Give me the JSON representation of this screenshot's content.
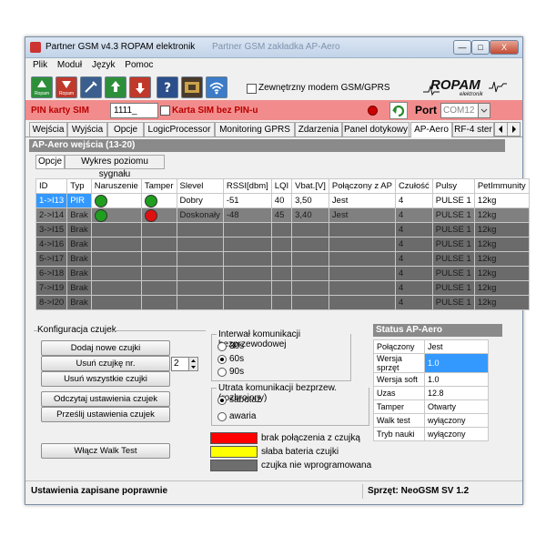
{
  "title": "Partner GSM v4.3 ROPAM elektronik",
  "title_ghost": "Partner GSM zakładka AP-Aero",
  "window_buttons": {
    "minimize": "—",
    "maximize": "□",
    "close": "X"
  },
  "menu": [
    "Plik",
    "Moduł",
    "Język",
    "Pomoc"
  ],
  "toolbar": {
    "labels": [
      "Ropam",
      "Ropam",
      "",
      "",
      "",
      "",
      "",
      ""
    ],
    "external_modem_label": "Zewnętrzny modem GSM/GPRS",
    "logo_text": "ROPAM",
    "logo_sub": "elektronik"
  },
  "pin": {
    "label": "PIN karty SIM",
    "value": "1111_",
    "no_pin_label": "Karta SIM bez PIN-u",
    "port_label": "Port",
    "port_value": "COM12"
  },
  "tabs": [
    "Wejścia",
    "Wyjścia",
    "Opcje",
    "LogicProcessor",
    "Monitoring GPRS",
    "Zdarzenia",
    "Panel dotykowy",
    "AP-Aero",
    "RF-4 ster"
  ],
  "active_tab": "AP-Aero",
  "section_title": "AP-Aero  wejścia  (13-20)",
  "subtabs": [
    "Opcje",
    "Wykres poziomu sygnału"
  ],
  "table": {
    "headers": [
      "ID",
      "Typ",
      "Naruszenie",
      "Tamper",
      "Slevel",
      "RSSI[dbm]",
      "LQI",
      "Vbat.[V]",
      "Połączony z AP",
      "Czułość",
      "Pulsy",
      "PetImmunity"
    ],
    "rows": [
      [
        "1->I13",
        "PIR",
        "",
        "",
        "Dobry",
        "-51",
        "40",
        "3,50",
        "Jest",
        "4",
        "PULSE 1",
        "12kg"
      ],
      [
        "2->I14",
        "Brak",
        "",
        "",
        "Doskonały",
        "-48",
        "45",
        "3,40",
        "Jest",
        "4",
        "PULSE 1",
        "12kg"
      ],
      [
        "3->I15",
        "Brak",
        "",
        "",
        "",
        "",
        "",
        "",
        "",
        "4",
        "PULSE 1",
        "12kg"
      ],
      [
        "4->I16",
        "Brak",
        "",
        "",
        "",
        "",
        "",
        "",
        "",
        "4",
        "PULSE 1",
        "12kg"
      ],
      [
        "5->I17",
        "Brak",
        "",
        "",
        "",
        "",
        "",
        "",
        "",
        "4",
        "PULSE 1",
        "12kg"
      ],
      [
        "6->I18",
        "Brak",
        "",
        "",
        "",
        "",
        "",
        "",
        "",
        "4",
        "PULSE 1",
        "12kg"
      ],
      [
        "7->I19",
        "Brak",
        "",
        "",
        "",
        "",
        "",
        "",
        "",
        "4",
        "PULSE 1",
        "12kg"
      ],
      [
        "8->I20",
        "Brak",
        "",
        "",
        "",
        "",
        "",
        "",
        "",
        "4",
        "PULSE 1",
        "12kg"
      ]
    ],
    "indicators": [
      {
        "naruszenie": "#1f9e1f",
        "tamper": "#1f9e1f"
      },
      {
        "naruszenie": "#1f9e1f",
        "tamper": "#e01010"
      }
    ]
  },
  "config": {
    "title": "Konfiguracja czujek",
    "add_button": "Dodaj nowe czujki",
    "remove_button": "Usuń czujkę nr.",
    "remove_number": "2",
    "remove_all_button": "Usuń wszystkie czujki",
    "read_button": "Odczytaj ustawienia czujek",
    "send_button": "Prześlij ustawienia czujek",
    "walk_test_button": "Włącz Walk Test"
  },
  "interval": {
    "title": "Interwał komunikacji bezprzewodowej",
    "options": [
      "30s",
      "60s",
      "90s"
    ],
    "selected": "60s"
  },
  "loss": {
    "title": "Utrata komunikacji bezprzew. (rozbrojony)",
    "options": [
      "sabotaż",
      "awaria"
    ],
    "selected": "sabotaż"
  },
  "legend": [
    {
      "color": "#ff0000",
      "label": "brak połączenia z czujką"
    },
    {
      "color": "#ffff00",
      "label": "słaba bateria czujki"
    },
    {
      "color": "#6e6e6e",
      "label": "czujka nie wprogramowana"
    }
  ],
  "status_panel": {
    "title": "Status AP-Aero",
    "rows": [
      [
        "Połączony",
        "Jest"
      ],
      [
        "Wersja sprzęt",
        "1.0"
      ],
      [
        "Wersja soft",
        "1.0"
      ],
      [
        "Uzas",
        "12.8"
      ],
      [
        "Tamper",
        "Otwarty"
      ],
      [
        "Walk test",
        "wyłączony"
      ],
      [
        "Tryb nauki",
        "wyłączony"
      ]
    ]
  },
  "statusbar": {
    "left": "Ustawienia zapisane poprawnie",
    "right": "Sprzęt: NeoGSM SV 1.2"
  }
}
